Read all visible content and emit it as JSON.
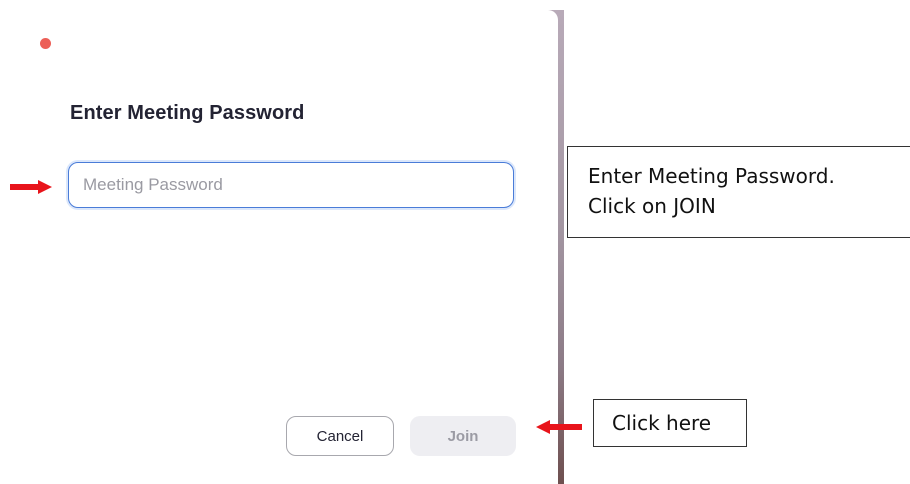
{
  "dialog": {
    "title": "Enter Meeting Password",
    "password_input": {
      "value": "",
      "placeholder": "Meeting Password"
    },
    "cancel_label": "Cancel",
    "join_label": "Join"
  },
  "annotations": {
    "callout_password_line1": "Enter Meeting Password.",
    "callout_password_line2": "Click on JOIN",
    "callout_join": "Click here"
  },
  "colors": {
    "close_button": "#ec5f57",
    "input_focus_border": "#4a7cd8",
    "annotation_arrow": "#e8141b",
    "join_disabled_bg": "#eeeef2"
  },
  "icons": {
    "close": "close-dot-icon",
    "annotation_arrows": "red-arrow-icon"
  }
}
